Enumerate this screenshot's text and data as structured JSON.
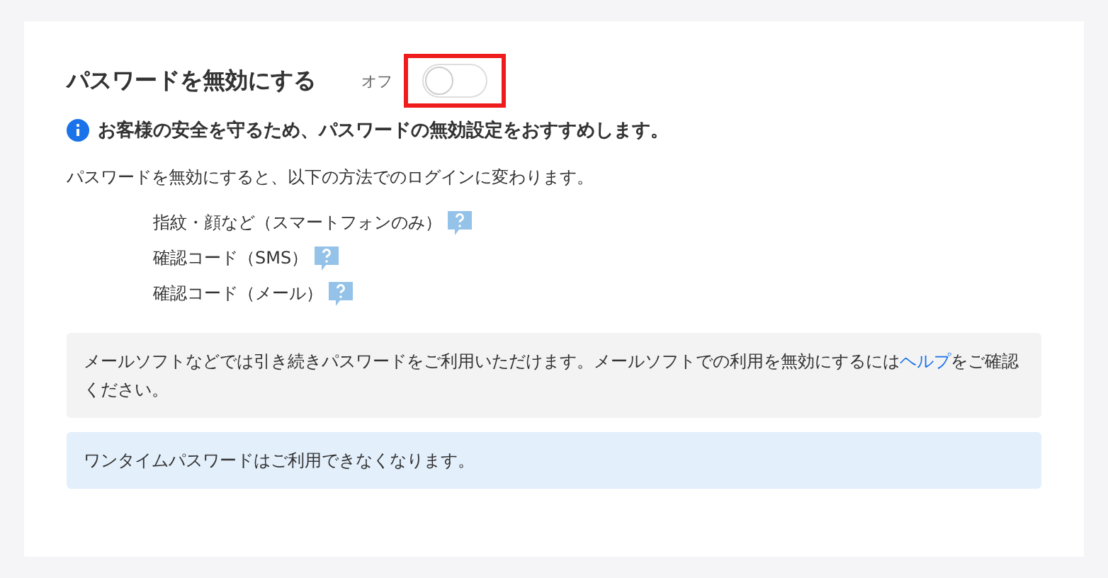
{
  "setting": {
    "title": "パスワードを無効にする",
    "state_label": "オフ",
    "toggle": {
      "on": false
    },
    "annotation": {
      "kind": "frame",
      "color": "#ee1c1c"
    }
  },
  "notice": "お客様の安全を守るため、パスワードの無効設定をおすすめします。",
  "description": "パスワードを無効にすると、以下の方法でのログインに変わります。",
  "methods": [
    {
      "label": "指紋・顔など（スマートフォンのみ）"
    },
    {
      "label": "確認コード（SMS）"
    },
    {
      "label": "確認コード（メール）"
    }
  ],
  "note": {
    "before": "メールソフトなどでは引き続きパスワードをご利用いただけます。メールソフトでの利用を無効にするには",
    "link": "ヘルプ",
    "after": "をご確認ください。"
  },
  "info_box": "ワンタイムパスワードはご利用できなくなります。"
}
